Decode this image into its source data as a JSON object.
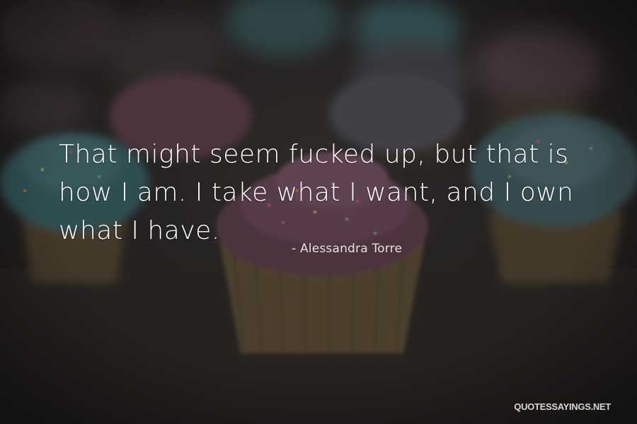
{
  "quote": {
    "text": "That might seem fucked up, but that is how I am. I take what I want, and I own what I have.",
    "author": "- Alessandra Torre"
  },
  "watermark": {
    "text": "QUOTESSAYINGS.NET"
  },
  "background": {
    "subject": "cupcakes-with-frosting-and-sprinkles",
    "colors": {
      "base": "#2b2927",
      "teal_frosting": "#3e6f74",
      "pink_frosting": "#6a4656",
      "cake": "#6b5a3e"
    }
  }
}
